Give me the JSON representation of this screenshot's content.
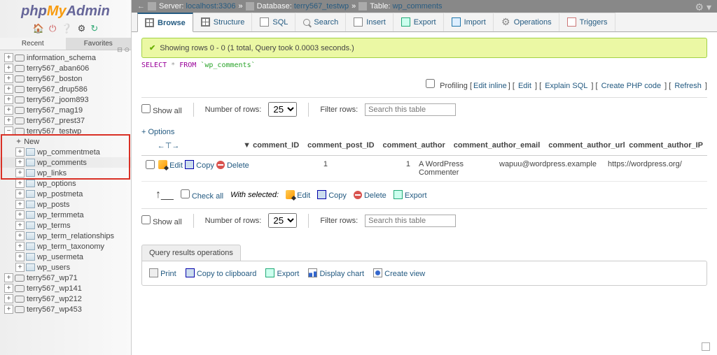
{
  "logo": {
    "php": "php",
    "my": "My",
    "admin": "Admin"
  },
  "sidebar_tabs": [
    "Recent",
    "Favorites"
  ],
  "collapse": "⊟ ⊙",
  "tree": [
    {
      "t": "db",
      "label": "information_schema"
    },
    {
      "t": "db",
      "label": "terry567_aban606"
    },
    {
      "t": "db",
      "label": "terry567_boston"
    },
    {
      "t": "db",
      "label": "terry567_drup586"
    },
    {
      "t": "db",
      "label": "terry567_joom893"
    },
    {
      "t": "db",
      "label": "terry567_mag19"
    },
    {
      "t": "db",
      "label": "terry567_prest37"
    },
    {
      "t": "db",
      "label": "terry567_testwp",
      "expanded": true
    },
    {
      "t": "new",
      "label": "New",
      "indent": 1
    },
    {
      "t": "tbl",
      "label": "wp_commentmeta",
      "indent": 1
    },
    {
      "t": "tbl",
      "label": "wp_comments",
      "indent": 1,
      "selected": true
    },
    {
      "t": "tbl",
      "label": "wp_links",
      "indent": 1
    },
    {
      "t": "tbl",
      "label": "wp_options",
      "indent": 1
    },
    {
      "t": "tbl",
      "label": "wp_postmeta",
      "indent": 1
    },
    {
      "t": "tbl",
      "label": "wp_posts",
      "indent": 1
    },
    {
      "t": "tbl",
      "label": "wp_termmeta",
      "indent": 1
    },
    {
      "t": "tbl",
      "label": "wp_terms",
      "indent": 1
    },
    {
      "t": "tbl",
      "label": "wp_term_relationships",
      "indent": 1
    },
    {
      "t": "tbl",
      "label": "wp_term_taxonomy",
      "indent": 1
    },
    {
      "t": "tbl",
      "label": "wp_usermeta",
      "indent": 1
    },
    {
      "t": "tbl",
      "label": "wp_users",
      "indent": 1
    },
    {
      "t": "db",
      "label": "terry567_wp71"
    },
    {
      "t": "db",
      "label": "terry567_wp141"
    },
    {
      "t": "db",
      "label": "terry567_wp212"
    },
    {
      "t": "db",
      "label": "terry567_wp453"
    }
  ],
  "breadcrumb": {
    "server_lbl": "Server:",
    "server": "localhost:3306",
    "db_lbl": "Database:",
    "db": "terry567_testwp",
    "tbl_lbl": "Table:",
    "tbl": "wp_comments",
    "sep": "»"
  },
  "tabs": [
    "Browse",
    "Structure",
    "SQL",
    "Search",
    "Insert",
    "Export",
    "Import",
    "Operations",
    "Triggers"
  ],
  "active_tab": "Browse",
  "msg_ok": "Showing rows 0 - 0 (1 total, Query took 0.0003 seconds.)",
  "sql": {
    "select": "SELECT",
    "star": "*",
    "from": "FROM",
    "tbl": "`wp_comments`"
  },
  "action_links": {
    "profiling": "Profiling",
    "editinline": "Edit inline",
    "edit": "Edit",
    "explain": "Explain SQL",
    "createphp": "Create PHP code",
    "refresh": "Refresh"
  },
  "showall": "Show all",
  "numrows_label": "Number of rows:",
  "numrows": "25",
  "filter_label": "Filter rows:",
  "filter_placeholder": "Search this table",
  "options_link": "+ Options",
  "columns": [
    "comment_ID",
    "comment_post_ID",
    "comment_author",
    "comment_author_email",
    "comment_author_url",
    "comment_author_IP"
  ],
  "sort_icons": "←⊤→",
  "row_actions": {
    "edit": "Edit",
    "copy": "Copy",
    "delete": "Delete"
  },
  "data_row": {
    "comment_ID": "1",
    "comment_post_ID": "1",
    "comment_author": "A WordPress Commenter",
    "comment_author_email": "wapuu@wordpress.example",
    "comment_author_url": "https://wordpress.org/",
    "comment_author_IP": ""
  },
  "checkall": "Check all",
  "withselected": "With selected:",
  "ws_actions": {
    "edit": "Edit",
    "copy": "Copy",
    "delete": "Delete",
    "export": "Export"
  },
  "qr_ops_title": "Query results operations",
  "qr_ops": {
    "print": "Print",
    "copyclip": "Copy to clipboard",
    "export": "Export",
    "chart": "Display chart",
    "createview": "Create view"
  },
  "arrow_up": "↑__"
}
